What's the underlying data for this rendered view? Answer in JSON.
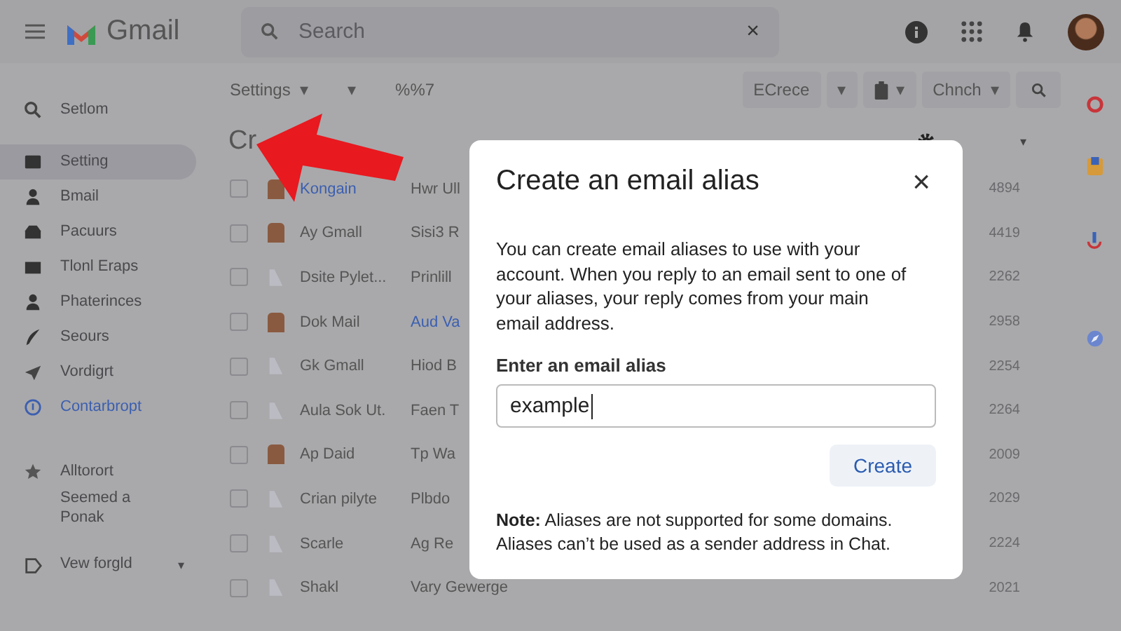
{
  "header": {
    "app_name": "Gmail",
    "search": {
      "placeholder": "Search",
      "clear": "×"
    }
  },
  "sidebar": {
    "items": [
      {
        "label": "Setlom",
        "selected": false,
        "link": false
      },
      {
        "label": "Setting",
        "selected": true,
        "link": false
      },
      {
        "label": "Bmail",
        "selected": false,
        "link": false
      },
      {
        "label": "Pacuurs",
        "selected": false,
        "link": false
      },
      {
        "label": "Tlonl Eraps",
        "selected": false,
        "link": false
      },
      {
        "label": "Phaterinces",
        "selected": false,
        "link": false
      },
      {
        "label": "Seours",
        "selected": false,
        "link": false
      },
      {
        "label": "Vordigrt",
        "selected": false,
        "link": false
      },
      {
        "label": "Contarbropt",
        "selected": false,
        "link": true
      },
      {
        "label": "Alltorort",
        "selected": false,
        "link": false
      },
      {
        "label": "Seemed a Ponak",
        "selected": false,
        "link": false
      },
      {
        "label": "Vew forgld",
        "selected": false,
        "link": false,
        "caret": "▾"
      }
    ]
  },
  "toolbar": {
    "left": [
      {
        "label": "Settings",
        "caret": "▾"
      },
      {
        "caret": "▾"
      },
      {
        "label": "%%7"
      }
    ],
    "right": [
      {
        "label": "ECrece"
      },
      {
        "caret": "▾"
      },
      {
        "caret": "▾",
        "kind": "clipboard"
      },
      {
        "label": "Chnch",
        "caret": "▾"
      }
    ]
  },
  "list": {
    "heading": "Cr",
    "header_caret": "▾",
    "rows": [
      {
        "sender": "Kongain",
        "subject": "Hwr Ull",
        "count": "4894",
        "checked": false,
        "kind": "photo",
        "unread": true,
        "subject_link": false
      },
      {
        "sender": "Ay Gmall",
        "subject": "Sisi3 R",
        "count": "4419",
        "checked": false,
        "kind": "photo",
        "unread": false,
        "subject_link": false
      },
      {
        "sender": "Dsite Pylet...",
        "subject": "Prinlill",
        "count": "2262",
        "checked": false,
        "kind": "generic",
        "unread": false,
        "subject_link": false
      },
      {
        "sender": "Dok Mail",
        "subject": "Aud Va",
        "count": "2958",
        "checked": false,
        "kind": "photo",
        "unread": false,
        "subject_link": true
      },
      {
        "sender": "Gk Gmall",
        "subject": "Hiod B",
        "count": "2254",
        "checked": false,
        "kind": "generic",
        "unread": false,
        "subject_link": false
      },
      {
        "sender": "Aula Sok Ut.",
        "subject": "Faen T",
        "count": "2264",
        "checked": false,
        "kind": "generic",
        "unread": false,
        "subject_link": false
      },
      {
        "sender": "Ap Daid",
        "subject": "Tp Wa",
        "count": "2009",
        "checked": false,
        "kind": "photo",
        "unread": false,
        "subject_link": false
      },
      {
        "sender": "Crian pilyte",
        "subject": "Plbdo",
        "count": "2029",
        "checked": false,
        "kind": "generic",
        "unread": false,
        "subject_link": false
      },
      {
        "sender": "Scarle",
        "subject": "Ag Re",
        "count": "2224",
        "checked": false,
        "kind": "generic",
        "unread": false,
        "subject_link": false
      },
      {
        "sender": "Shakl",
        "subject": "Vary Gewerge",
        "count": "2021",
        "checked": false,
        "kind": "generic",
        "unread": false,
        "subject_link": false
      }
    ]
  },
  "dialog": {
    "title": "Create an email alias",
    "close": "×",
    "body": "You can create email aliases to use with your account. When you reply to an email sent to one of your aliases, your reply comes from your main email address.",
    "field_label": "Enter an email alias",
    "field_value": "example",
    "button": "Create",
    "note": "**Note:** Aliases are not supported for some domains. Aliases can’t be used as a sender address in Chat."
  }
}
